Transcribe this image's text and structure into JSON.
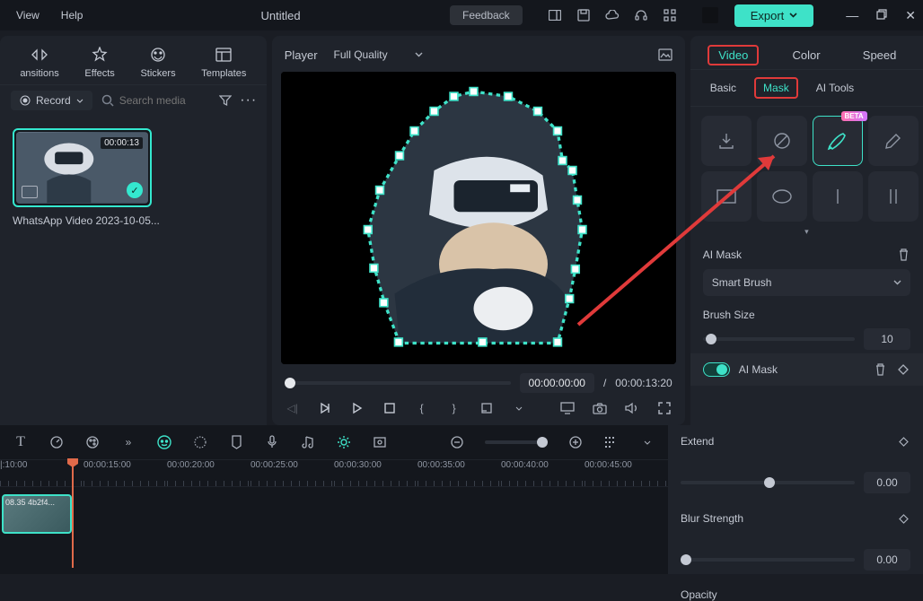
{
  "titlebar": {
    "menu": {
      "view": "View",
      "help": "Help"
    },
    "title": "Untitled",
    "feedback": "Feedback",
    "export": "Export"
  },
  "left_panel": {
    "tabs": {
      "transitions": "ansitions",
      "effects": "Effects",
      "stickers": "Stickers",
      "templates": "Templates"
    },
    "record": "Record",
    "search_placeholder": "Search media",
    "clip": {
      "duration": "00:00:13",
      "name": "WhatsApp Video 2023-10-05...",
      "check": "✓"
    }
  },
  "player": {
    "label": "Player",
    "quality": "Full Quality",
    "current_time": "00:00:00:00",
    "separator": "/",
    "total_time": "00:00:13:20"
  },
  "right_panel": {
    "tabs1": {
      "video": "Video",
      "color": "Color",
      "speed": "Speed"
    },
    "tabs2": {
      "basic": "Basic",
      "mask": "Mask",
      "aitools": "AI Tools"
    },
    "beta": "BETA",
    "ai_mask_label": "AI Mask",
    "ai_mask_select": "Smart Brush",
    "brush_size_label": "Brush Size",
    "brush_size_value": "10",
    "ai_mask_toggle": "AI Mask",
    "extend_label": "Extend",
    "extend_value": "0.00",
    "blur_label": "Blur Strength",
    "blur_value": "0.00",
    "opacity_label": "Opacity"
  },
  "timeline": {
    "ticks": [
      "|:10:00",
      "00:00:15:00",
      "00:00:20:00",
      "00:00:25:00",
      "00:00:30:00",
      "00:00:35:00",
      "00:00:40:00",
      "00:00:45:00"
    ],
    "clip_label": "08.35 4b2f4..."
  }
}
